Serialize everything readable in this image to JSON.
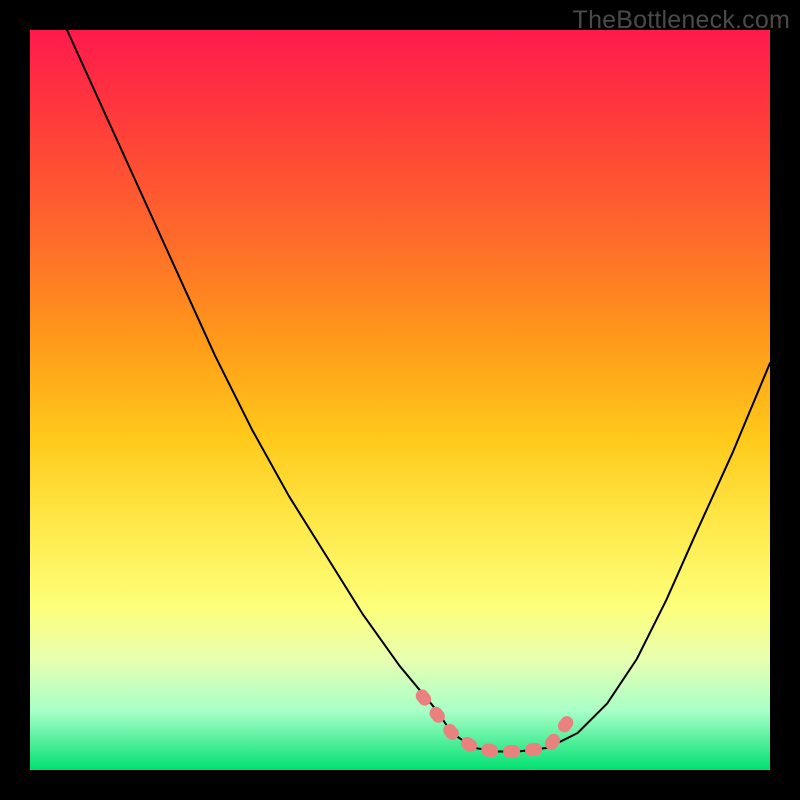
{
  "watermark": "TheBottleneck.com",
  "colors": {
    "accent_pink": "#e9817f",
    "curve_black": "#000000",
    "gradient_top": "#ff1a4d",
    "gradient_bottom": "#00e070"
  },
  "chart_data": {
    "type": "line",
    "title": "",
    "xlabel": "",
    "ylabel": "",
    "xlim": [
      0,
      100
    ],
    "ylim": [
      0,
      100
    ],
    "grid": false,
    "series": [
      {
        "name": "bottleneck-curve",
        "x": [
          5,
          10,
          15,
          20,
          25,
          30,
          35,
          40,
          45,
          50,
          55,
          57,
          60,
          63,
          66,
          70,
          74,
          78,
          82,
          86,
          90,
          95,
          100
        ],
        "y": [
          100,
          89,
          78,
          67,
          56,
          46,
          37,
          29,
          21,
          14,
          8,
          5,
          3,
          2.5,
          2.5,
          3,
          5,
          9,
          15,
          23,
          32,
          43,
          55
        ]
      }
    ],
    "highlight": {
      "name": "flat-bottom-accent",
      "x": [
        53,
        57,
        60,
        63,
        66,
        70,
        73
      ],
      "y": [
        10,
        5,
        3,
        2.5,
        2.5,
        3,
        7
      ]
    }
  }
}
